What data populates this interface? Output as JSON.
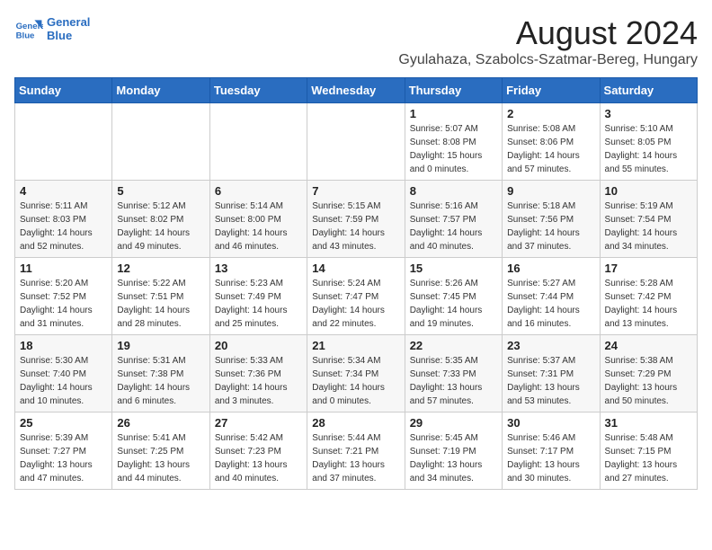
{
  "header": {
    "logo_line1": "General",
    "logo_line2": "Blue",
    "title": "August 2024",
    "subtitle": "Gyulahaza, Szabolcs-Szatmar-Bereg, Hungary"
  },
  "weekdays": [
    "Sunday",
    "Monday",
    "Tuesday",
    "Wednesday",
    "Thursday",
    "Friday",
    "Saturday"
  ],
  "weeks": [
    [
      {
        "day": "",
        "info": ""
      },
      {
        "day": "",
        "info": ""
      },
      {
        "day": "",
        "info": ""
      },
      {
        "day": "",
        "info": ""
      },
      {
        "day": "1",
        "info": "Sunrise: 5:07 AM\nSunset: 8:08 PM\nDaylight: 15 hours and 0 minutes."
      },
      {
        "day": "2",
        "info": "Sunrise: 5:08 AM\nSunset: 8:06 PM\nDaylight: 14 hours and 57 minutes."
      },
      {
        "day": "3",
        "info": "Sunrise: 5:10 AM\nSunset: 8:05 PM\nDaylight: 14 hours and 55 minutes."
      }
    ],
    [
      {
        "day": "4",
        "info": "Sunrise: 5:11 AM\nSunset: 8:03 PM\nDaylight: 14 hours and 52 minutes."
      },
      {
        "day": "5",
        "info": "Sunrise: 5:12 AM\nSunset: 8:02 PM\nDaylight: 14 hours and 49 minutes."
      },
      {
        "day": "6",
        "info": "Sunrise: 5:14 AM\nSunset: 8:00 PM\nDaylight: 14 hours and 46 minutes."
      },
      {
        "day": "7",
        "info": "Sunrise: 5:15 AM\nSunset: 7:59 PM\nDaylight: 14 hours and 43 minutes."
      },
      {
        "day": "8",
        "info": "Sunrise: 5:16 AM\nSunset: 7:57 PM\nDaylight: 14 hours and 40 minutes."
      },
      {
        "day": "9",
        "info": "Sunrise: 5:18 AM\nSunset: 7:56 PM\nDaylight: 14 hours and 37 minutes."
      },
      {
        "day": "10",
        "info": "Sunrise: 5:19 AM\nSunset: 7:54 PM\nDaylight: 14 hours and 34 minutes."
      }
    ],
    [
      {
        "day": "11",
        "info": "Sunrise: 5:20 AM\nSunset: 7:52 PM\nDaylight: 14 hours and 31 minutes."
      },
      {
        "day": "12",
        "info": "Sunrise: 5:22 AM\nSunset: 7:51 PM\nDaylight: 14 hours and 28 minutes."
      },
      {
        "day": "13",
        "info": "Sunrise: 5:23 AM\nSunset: 7:49 PM\nDaylight: 14 hours and 25 minutes."
      },
      {
        "day": "14",
        "info": "Sunrise: 5:24 AM\nSunset: 7:47 PM\nDaylight: 14 hours and 22 minutes."
      },
      {
        "day": "15",
        "info": "Sunrise: 5:26 AM\nSunset: 7:45 PM\nDaylight: 14 hours and 19 minutes."
      },
      {
        "day": "16",
        "info": "Sunrise: 5:27 AM\nSunset: 7:44 PM\nDaylight: 14 hours and 16 minutes."
      },
      {
        "day": "17",
        "info": "Sunrise: 5:28 AM\nSunset: 7:42 PM\nDaylight: 14 hours and 13 minutes."
      }
    ],
    [
      {
        "day": "18",
        "info": "Sunrise: 5:30 AM\nSunset: 7:40 PM\nDaylight: 14 hours and 10 minutes."
      },
      {
        "day": "19",
        "info": "Sunrise: 5:31 AM\nSunset: 7:38 PM\nDaylight: 14 hours and 6 minutes."
      },
      {
        "day": "20",
        "info": "Sunrise: 5:33 AM\nSunset: 7:36 PM\nDaylight: 14 hours and 3 minutes."
      },
      {
        "day": "21",
        "info": "Sunrise: 5:34 AM\nSunset: 7:34 PM\nDaylight: 14 hours and 0 minutes."
      },
      {
        "day": "22",
        "info": "Sunrise: 5:35 AM\nSunset: 7:33 PM\nDaylight: 13 hours and 57 minutes."
      },
      {
        "day": "23",
        "info": "Sunrise: 5:37 AM\nSunset: 7:31 PM\nDaylight: 13 hours and 53 minutes."
      },
      {
        "day": "24",
        "info": "Sunrise: 5:38 AM\nSunset: 7:29 PM\nDaylight: 13 hours and 50 minutes."
      }
    ],
    [
      {
        "day": "25",
        "info": "Sunrise: 5:39 AM\nSunset: 7:27 PM\nDaylight: 13 hours and 47 minutes."
      },
      {
        "day": "26",
        "info": "Sunrise: 5:41 AM\nSunset: 7:25 PM\nDaylight: 13 hours and 44 minutes."
      },
      {
        "day": "27",
        "info": "Sunrise: 5:42 AM\nSunset: 7:23 PM\nDaylight: 13 hours and 40 minutes."
      },
      {
        "day": "28",
        "info": "Sunrise: 5:44 AM\nSunset: 7:21 PM\nDaylight: 13 hours and 37 minutes."
      },
      {
        "day": "29",
        "info": "Sunrise: 5:45 AM\nSunset: 7:19 PM\nDaylight: 13 hours and 34 minutes."
      },
      {
        "day": "30",
        "info": "Sunrise: 5:46 AM\nSunset: 7:17 PM\nDaylight: 13 hours and 30 minutes."
      },
      {
        "day": "31",
        "info": "Sunrise: 5:48 AM\nSunset: 7:15 PM\nDaylight: 13 hours and 27 minutes."
      }
    ]
  ]
}
